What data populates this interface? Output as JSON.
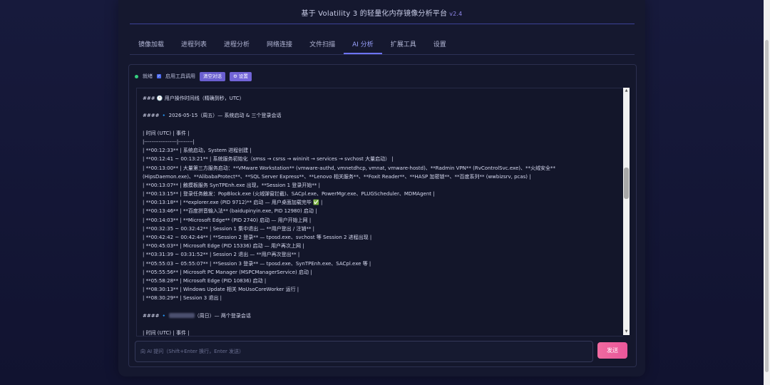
{
  "app": {
    "title": "基于 Volatility 3 的轻量化内存镜像分析平台",
    "version": "v2.4"
  },
  "tabs": [
    {
      "label": "镜像加载"
    },
    {
      "label": "进程列表"
    },
    {
      "label": "进程分析"
    },
    {
      "label": "网络连接"
    },
    {
      "label": "文件扫描"
    },
    {
      "label": "AI 分析",
      "active": true
    },
    {
      "label": "扩展工具"
    },
    {
      "label": "设置"
    }
  ],
  "toolbar": {
    "status_label": "就绪",
    "tool_call_label": "启用工具调用",
    "tool_call_checked": true,
    "clear_label": "清空对话",
    "settings_label": "⚙ 设置"
  },
  "chat": {
    "lines": [
      "### 🕐 用户操作时间线（精确到秒，UTC）",
      "",
      "#### 🔹 2026-05-15（周五）— 系统启动 & 三个登录会话",
      "",
      "| 时间 (UTC) | 事件 |",
      "|------------------|--------|",
      "| **00:12:33** | 系统启动，System 进程创建 |",
      "| **00:12:41 ~ 00:13:21** | 系统服务初始化（smss → csrss → wininit → services → svchost 大量启动） |",
      "| **00:13:00** | 大量第三方服务启动：**VMware Workstation** (vmware-authd, vmnetdhcp, vmnat, vmware-hostd)、**Radmin VPN** (RvControlSvc.exe)、**火绒安全**",
      "(HipsDaemon.exe)、**AlibabaProtect**、**SQL Server Express**、**Lenovo 相关服务**、**Foxit Reader**、**HASP 加密锁**、**百度系列** (wwbizsrv, pcas) |",
      "| **00:13:07** | 触摸板服务 SynTPEnh.exe 出现，**Session 1 登录开始** |",
      "| **00:13:15** | 登录任务触发：PopBlock.exe (火绒弹窗拦截)、SACpl.exe、PowerMgr.exe、PLUGScheduler、MDMAgent |",
      "| **00:13:18** | **explorer.exe (PID 9712)** 启动 — 用户桌面加载完毕 ✅ |",
      "| **00:13:46** | **百度拼音输入法** (baidupinyin.exe, PID 12980) 启动 |",
      "| **00:14:03** | **Microsoft Edge** (PID 2740) 启动 — 用户开始上网 |",
      "| **00:32:35 ~ 00:32:42** | Session 1 集中退出 — **用户登出 / 注销** |",
      "| **00:42:42 ~ 00:42:44** | **Session 2 登录** — tposd.exe、svchost 等 Session 2 进程出现 |",
      "| **00:45:03** | Microsoft Edge (PID 15336) 启动 — 用户再次上网 |",
      "| **03:31:39 ~ 03:31:52** | Session 2 退出 — **用户再次登出** |",
      "| **05:55:03 ~ 05:55:07** | **Session 3 登录** — tposd.exe、SynTPEnh.exe、SACpl.exe 等 |",
      "| **05:55:56** | Microsoft PC Manager (MSPCManagerService) 启动 |",
      "| **05:58:28** | Microsoft Edge (PID 10836) 启动 |",
      "| **08:30:13** | Windows Update 相关 MoUsoCoreWorker 运行 |",
      "| **08:30:29** | Session 3 退出 |",
      "",
      "#### 🔹 [BLUR]（周日）— 两个登录会话",
      "",
      "| 时间 (UTC) | 事件 |"
    ]
  },
  "input": {
    "placeholder": "向 AI 提问（Shift+Enter 换行，Enter 发送）",
    "value": ""
  },
  "send_label": "发送"
}
